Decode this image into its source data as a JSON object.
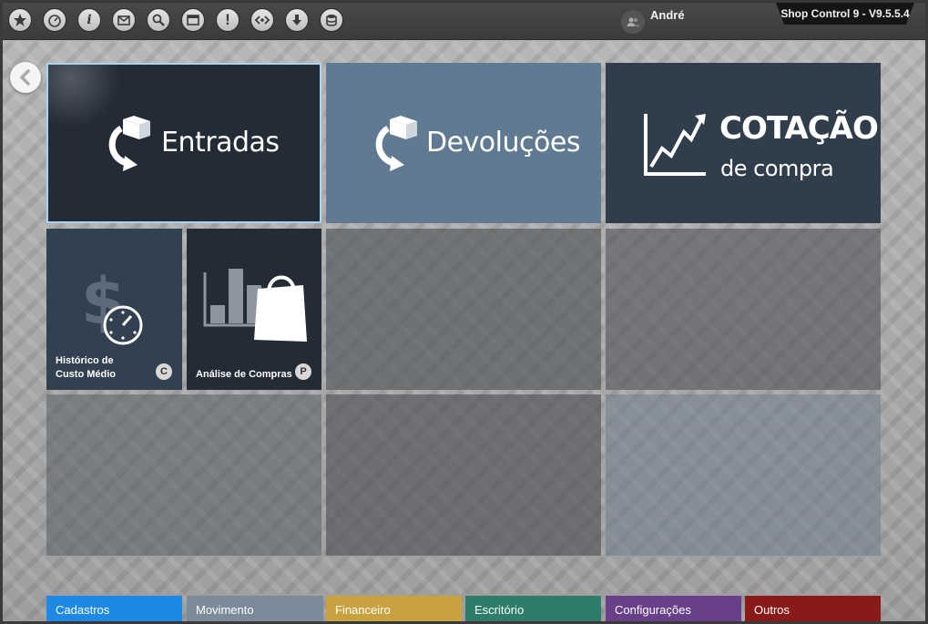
{
  "header": {
    "user_name": "André",
    "version": "Shop Control 9 - V9.5.5.4",
    "toolbar_icons": [
      "star-icon",
      "speedometer-icon",
      "info-icon",
      "mail-icon",
      "search-icon",
      "window-icon",
      "alert-icon",
      "code-icon",
      "download-icon",
      "database-icon"
    ]
  },
  "tiles": {
    "entradas": {
      "label": "Entradas"
    },
    "devolucoes": {
      "label": "Devoluções"
    },
    "cotacao": {
      "line1": "COTAÇÃO",
      "line2": "de compra"
    },
    "historico": {
      "label_line1": "Histórico de",
      "label_line2": "Custo Médio",
      "badge": "C"
    },
    "analise": {
      "label": "Análise de Compras",
      "badge": "P"
    }
  },
  "tabs": [
    {
      "label": "Cadastros",
      "color": "#1e88e5"
    },
    {
      "label": "Movimento",
      "color": "#7b8b99"
    },
    {
      "label": "Financeiro",
      "color": "#c9a240"
    },
    {
      "label": "Escritório",
      "color": "#2e7d6b"
    },
    {
      "label": "Configurações",
      "color": "#6a3f8a"
    },
    {
      "label": "Outros",
      "color": "#8a1a1a"
    }
  ],
  "colors": {
    "tile_entradas": "#222b36",
    "tile_devolucoes": "#5f7a91",
    "tile_cotacao": "#303d4b",
    "selection_border": "#a6d4f2"
  }
}
